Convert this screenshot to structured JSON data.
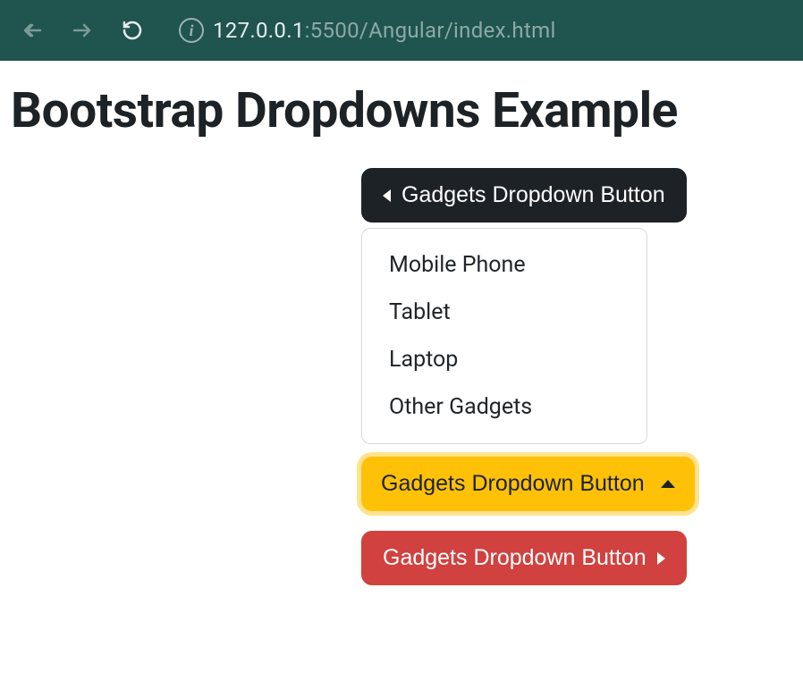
{
  "browser": {
    "url_ip": "127.0.0.1",
    "url_port": ":5500",
    "url_path": "/Angular/index.html"
  },
  "page": {
    "title": "Bootstrap Dropdowns Example"
  },
  "buttons": {
    "dark_label": "Gadgets Dropdown Button",
    "warning_label": "Gadgets Dropdown Button",
    "danger_label": "Gadgets Dropdown Button"
  },
  "menu": {
    "items": [
      "Mobile Phone",
      "Tablet",
      "Laptop",
      "Other Gadgets"
    ]
  }
}
